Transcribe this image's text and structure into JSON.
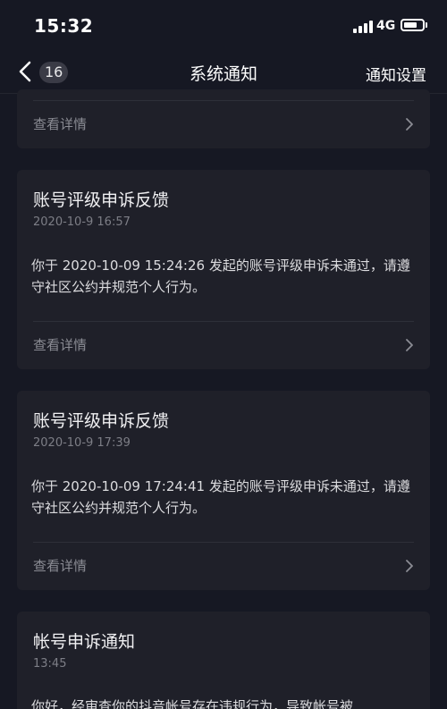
{
  "status_bar": {
    "time": "15:32",
    "network": "4G",
    "battery_level": 0.75
  },
  "nav": {
    "back_badge": "16",
    "title": "系统通知",
    "action": "通知设置"
  },
  "colors": {
    "background": "#161823",
    "card": "#1f2029",
    "text_primary": "#f0f0f2",
    "text_secondary": "#8b8c94"
  },
  "notifications": [
    {
      "title": "",
      "time": "",
      "body": "",
      "detail_label": "查看详情",
      "chevron": "chevron-right-icon"
    },
    {
      "title": "账号评级申诉反馈",
      "time": "2020-10-9 16:57",
      "body": "你于 2020-10-09 15:24:26 发起的账号评级申诉未通过，请遵守社区公约并规范个人行为。",
      "detail_label": "查看详情",
      "chevron": "chevron-right-icon"
    },
    {
      "title": "账号评级申诉反馈",
      "time": "2020-10-9 17:39",
      "body": "你于 2020-10-09 17:24:41 发起的账号评级申诉未通过，请遵守社区公约并规范个人行为。",
      "detail_label": "查看详情",
      "chevron": "chevron-right-icon"
    },
    {
      "title": "帐号申诉通知",
      "time": "13:45",
      "body": "你好，经审查你的抖音帐号存在违规行为，导致帐号被",
      "detail_label": "",
      "chevron": ""
    }
  ]
}
